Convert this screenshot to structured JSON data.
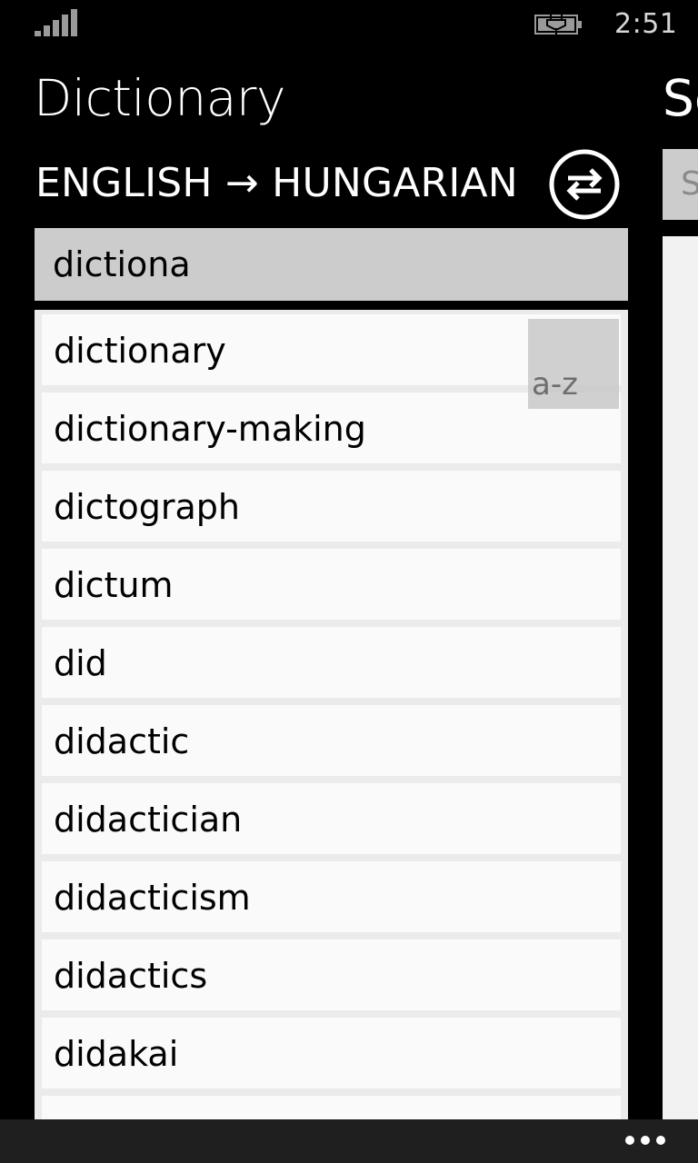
{
  "status_bar": {
    "time": "2:51",
    "signal_icon": "signal-strength-icon",
    "battery_icon": "battery-charging-icon"
  },
  "header": {
    "title": "Dictionary",
    "next_pivot_title": "Se"
  },
  "language": {
    "direction_label": "ENGLISH → HUNGARIAN",
    "swap_icon": "swap-arrows-icon"
  },
  "search": {
    "value": "dictiona"
  },
  "peek": {
    "input_placeholder": "S"
  },
  "word_list": {
    "az_label": "a-z",
    "items": [
      "dictionary",
      "dictionary-making",
      "dictograph",
      "dictum",
      "did",
      "didactic",
      "didactician",
      "didacticism",
      "didactics",
      "didakai"
    ]
  },
  "app_bar": {
    "more_icon": "more-ellipsis-icon"
  },
  "colors": {
    "background": "#000000",
    "search_bg": "#cccccc",
    "list_bg": "#ebebeb",
    "item_bg": "#fafafa",
    "app_bar_bg": "#1f1f1f"
  }
}
